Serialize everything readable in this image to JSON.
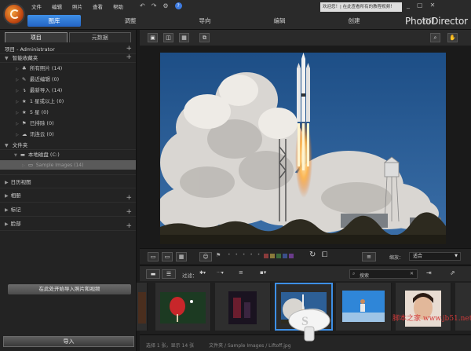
{
  "menu": {
    "file": "文件",
    "edit": "编辑",
    "photo": "照片",
    "view": "查看",
    "help": "帮助"
  },
  "quick_actions": {
    "undo": "↶",
    "redo": "↷",
    "settings": "⚙",
    "help": "?"
  },
  "welcome_text": "欢迎您！| 在此查看所有的教程视频！",
  "window_controls": {
    "minimize": "_",
    "restore": "▢",
    "close": "✕"
  },
  "brand": "PhotoDirector",
  "mode_tabs": [
    "图库",
    "调整",
    "导向",
    "编辑",
    "创建",
    "打印"
  ],
  "left": {
    "tabs": [
      "项目",
      "元数据"
    ],
    "project_header": "项目 - Administrator",
    "smart_header": "智能收藏夹",
    "smart_items": [
      {
        "icon": "tree-icon",
        "glyph": "♣",
        "label": "所有照片 (14)"
      },
      {
        "icon": "recent-edit-icon",
        "glyph": "✎",
        "label": "最近编辑 (0)"
      },
      {
        "icon": "recent-import-icon",
        "glyph": "↴",
        "label": "最新导入 (14)"
      },
      {
        "icon": "star-icon",
        "glyph": "★",
        "label": "1 星或以上 (0)"
      },
      {
        "icon": "star-icon",
        "glyph": "★",
        "label": "5 星 (0)"
      },
      {
        "icon": "flag-icon",
        "glyph": "⚑",
        "label": "已排除 (0)"
      },
      {
        "icon": "cloud-icon",
        "glyph": "☁",
        "label": "讯连云 (0)"
      }
    ],
    "folder_header": "文件夹",
    "local_disk": "本地磁盘 (C:)",
    "sample_folder": "Sample Images (14)",
    "sections": [
      "日历视图",
      "相册",
      "标记",
      "脸部"
    ],
    "import_hint": "在此处开始导入照片和视频",
    "import_button": "导入"
  },
  "viewer_tools": {
    "compare": "⊞",
    "search": "🔍",
    "hand": "✋"
  },
  "ctrl": {
    "zoom_label": "缩放：",
    "zoom_value": "适合"
  },
  "filter": {
    "label": "过滤：",
    "search_placeholder": "搜索",
    "sort_icon": "≡"
  },
  "status": "选择 1 张，显示 14 张          文件夹 / Sample Images / Liftoff.jpg",
  "watermark": "脚本之家 www.jb51.net"
}
